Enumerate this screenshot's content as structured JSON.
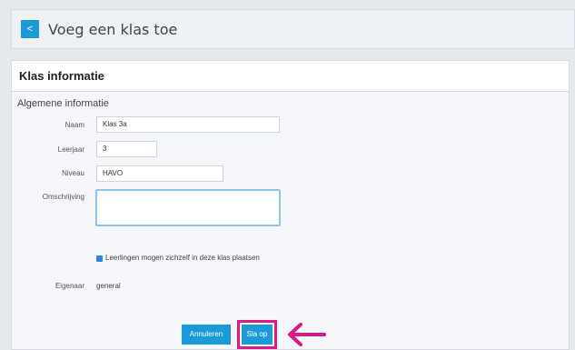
{
  "header": {
    "back_label": "<",
    "title": "Voeg een klas toe"
  },
  "panel": {
    "title": "Klas informatie",
    "section_title": "Algemene informatie"
  },
  "form": {
    "naam_label": "Naam",
    "naam_value": "Klas 3a",
    "leerjaar_label": "Leerjaar",
    "leerjaar_value": "3",
    "niveau_label": "Niveau",
    "niveau_value": "HAVO",
    "omschrijving_label": "Omschrijving",
    "omschrijving_value": "",
    "checkbox_label": "Leerlingen mogen zichzelf in deze klas plaatsen",
    "checkbox_checked": true,
    "eigenaar_label": "Eigenaar",
    "eigenaar_value": "general"
  },
  "actions": {
    "cancel_label": "Annuleren",
    "save_label": "Sla op"
  },
  "colors": {
    "accent": "#1a9ad6",
    "highlight": "#d61a8a"
  },
  "icons": {
    "back": "chevron-left-icon",
    "arrow": "arrow-left-icon"
  }
}
